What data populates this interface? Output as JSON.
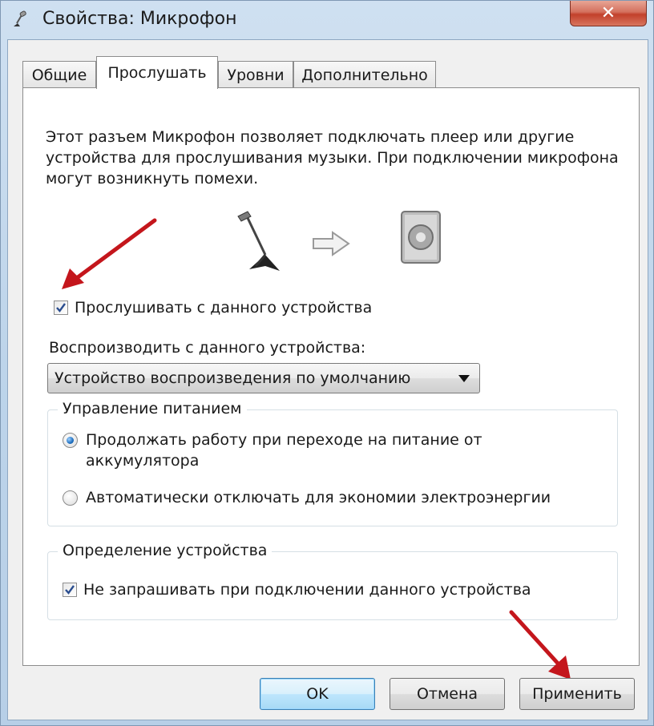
{
  "window": {
    "title": "Свойства: Микрофон",
    "close_label": "✕",
    "accent": "#3c7fb1",
    "close_color": "#c2402b"
  },
  "tabs": [
    {
      "label": "Общие"
    },
    {
      "label": "Прослушать",
      "active": true
    },
    {
      "label": "Уровни"
    },
    {
      "label": "Дополнительно"
    }
  ],
  "listen": {
    "description": "Этот разъем Микрофон позволяет подключать плеер или другие устройства для прослушивания музыки. При подключении микрофона могут возникнуть помехи.",
    "listen_checkbox_label": "Прослушивать с данного устройства",
    "listen_checked": true,
    "playback_label": "Воспроизводить с данного устройства:",
    "playback_selected": "Устройство воспроизведения по умолчанию"
  },
  "power": {
    "legend": "Управление питанием",
    "options": [
      {
        "label": "Продолжать работу при переходе на питание от аккумулятора",
        "selected": true
      },
      {
        "label": "Автоматически отключать для экономии электроэнергии",
        "selected": false
      }
    ]
  },
  "detection": {
    "legend": "Определение устройства",
    "checkbox_label": "Не запрашивать при подключении данного устройства",
    "checked": true
  },
  "buttons": {
    "ok": "OK",
    "cancel": "Отмена",
    "apply": "Применить"
  },
  "icons": {
    "app": "microphone-icon",
    "mic": "microphone-stand-icon",
    "arrow": "right-arrow-icon",
    "speaker": "speaker-icon",
    "annotation": "red-arrow-annotation"
  },
  "annotation_color": "#c4161c"
}
